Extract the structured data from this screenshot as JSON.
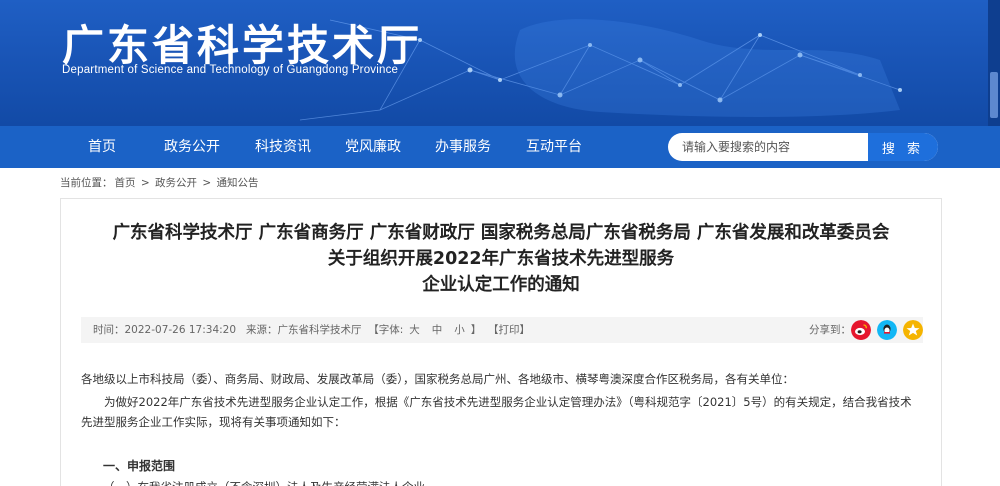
{
  "header": {
    "title": "广东省科学技术厅",
    "subtitle": "Department of Science and Technology of Guangdong Province"
  },
  "nav": {
    "items": [
      {
        "label": "首页"
      },
      {
        "label": "政务公开"
      },
      {
        "label": "科技资讯"
      },
      {
        "label": "党风廉政"
      },
      {
        "label": "办事服务"
      },
      {
        "label": "互动平台"
      }
    ],
    "search": {
      "placeholder": "请输入要搜索的内容",
      "button_label": "搜 索"
    }
  },
  "breadcrumb": {
    "prefix": "当前位置：",
    "items": [
      "首页",
      "政务公开",
      "通知公告"
    ],
    "separator": ">"
  },
  "article": {
    "title_line1": "广东省科学技术厅 广东省商务厅 广东省财政厅 国家税务总局广东省税务局 广东省发展和改革委员会",
    "title_line2": "关于组织开展2022年广东省技术先进型服务",
    "title_line3": "企业认定工作的通知",
    "meta": {
      "time_label": "时间：",
      "time_value": "2022-07-26 17:34:20",
      "source_label": "来源：",
      "source_value": "广东省科学技术厅",
      "font_label": "【字体:",
      "font_sizes": [
        "大",
        "中",
        "小"
      ],
      "font_close": "】",
      "print_label": "【打印】",
      "share_label": "分享到："
    },
    "addressee": "各地级以上市科技局（委）、商务局、财政局、发展改革局（委），国家税务总局广州、各地级市、横琴粤澳深度合作区税务局，各有关单位：",
    "paragraph1": "为做好2022年广东省技术先进型服务企业认定工作，根据《广东省技术先进型服务企业认定管理办法》（粤科规范字〔2021〕5号）的有关规定，结合我省技术先进型服务企业工作实际，现将有关事项通知如下：",
    "section1": "一、申报范围",
    "section1_item": "（一）在我省注册成立（不含深圳）法人及生产经营满法人企业"
  },
  "share_icons": [
    "weibo-icon",
    "qq-icon",
    "qzone-icon"
  ],
  "colors": {
    "banner": "#1a56b8",
    "nav": "#1b62c6",
    "search_button": "#1e6fdc",
    "weibo": "#e6162d",
    "qq": "#12b7f5",
    "qzone": "#f5b400"
  }
}
